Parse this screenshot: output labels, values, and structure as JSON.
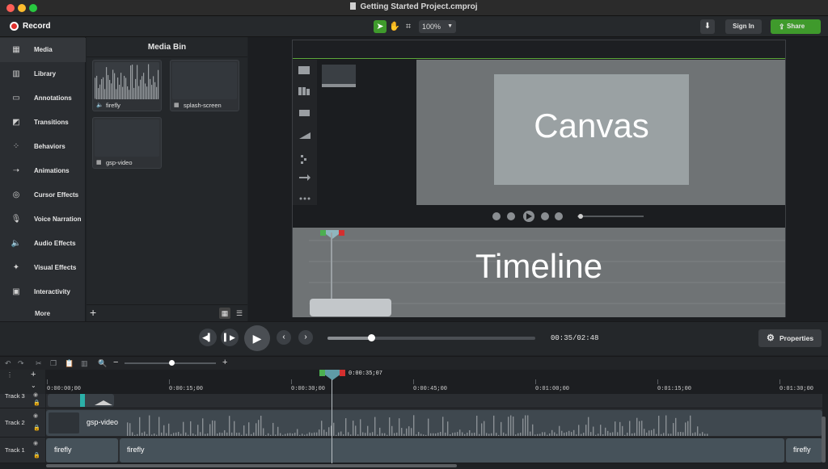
{
  "window": {
    "title": "Getting Started Project.cmproj"
  },
  "colors": {
    "accent_green": "#3f9a2c",
    "record_red": "#e0302c",
    "selection_green": "#5da83a"
  },
  "toolbar": {
    "record_label": "Record",
    "tools": [
      {
        "icon": "pointer-icon",
        "glyph": "➤"
      },
      {
        "icon": "hand-icon",
        "glyph": "✋"
      },
      {
        "icon": "crop-icon",
        "glyph": "⌗"
      }
    ],
    "zoom_value": "100%",
    "sign_in_label": "Sign In",
    "share_label": "Share"
  },
  "sidebar": {
    "items": [
      {
        "label": "Media",
        "icon": "film-strip-icon",
        "glyph": "▦"
      },
      {
        "label": "Library",
        "icon": "books-icon",
        "glyph": "▥"
      },
      {
        "label": "Annotations",
        "icon": "callout-icon",
        "glyph": "▭"
      },
      {
        "label": "Transitions",
        "icon": "transition-icon",
        "glyph": "◩"
      },
      {
        "label": "Behaviors",
        "icon": "behaviors-icon",
        "glyph": "⁘"
      },
      {
        "label": "Animations",
        "icon": "animation-arrow-icon",
        "glyph": "➝"
      },
      {
        "label": "Cursor Effects",
        "icon": "cursor-effects-icon",
        "glyph": "◎"
      },
      {
        "label": "Voice Narration",
        "icon": "microphone-icon",
        "glyph": "🎙"
      },
      {
        "label": "Audio Effects",
        "icon": "speaker-icon",
        "glyph": "🔈"
      },
      {
        "label": "Visual Effects",
        "icon": "magic-wand-icon",
        "glyph": "✦"
      },
      {
        "label": "Interactivity",
        "icon": "interactivity-icon",
        "glyph": "▣"
      }
    ],
    "more_label": "More"
  },
  "media_bin": {
    "title": "Media Bin",
    "items": [
      {
        "name": "firefly",
        "kind": "audio",
        "icon": "audio-icon",
        "glyph": "🔈"
      },
      {
        "name": "splash-screen",
        "kind": "video",
        "icon": "video-icon",
        "glyph": "▦"
      },
      {
        "name": "gsp-video",
        "kind": "video",
        "icon": "video-icon",
        "glyph": "▦"
      }
    ]
  },
  "preview": {
    "canvas_label": "Canvas",
    "timeline_label": "Timeline"
  },
  "transport": {
    "time_readout": "00:35/02:48",
    "progress": 0.21,
    "properties_label": "Properties"
  },
  "timeline": {
    "zoom_level": 0.51,
    "playhead_time": "0:00:35;07",
    "ruler_ticks": [
      "0:00:00;00",
      "0:00:15;00",
      "0:00:30;00",
      "0:00:45;00",
      "0:01:00;00",
      "0:01:15;00",
      "0:01:30;00"
    ],
    "tracks": [
      {
        "name": "Track 3",
        "clips": []
      },
      {
        "name": "Track 2",
        "clips": [
          {
            "label": "gsp-video"
          }
        ]
      },
      {
        "name": "Track 1",
        "clips": [
          {
            "label": "firefly"
          },
          {
            "label": "firefly"
          },
          {
            "label": "firefly"
          }
        ]
      }
    ]
  }
}
